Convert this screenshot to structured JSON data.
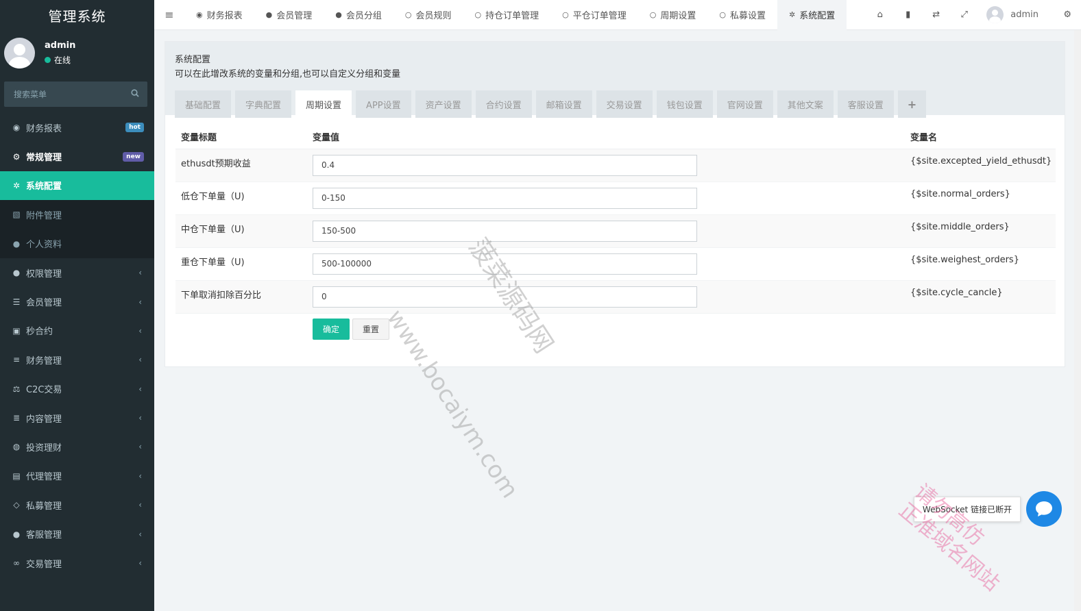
{
  "brand": "管理系统",
  "user": {
    "name": "admin",
    "status": "在线"
  },
  "search": {
    "placeholder": "搜索菜单"
  },
  "sidebar": {
    "items": [
      {
        "label": "财务报表",
        "badge": "hot"
      },
      {
        "label": "常规管理",
        "badge": "new"
      },
      {
        "label": "系统配置"
      },
      {
        "label": "附件管理"
      },
      {
        "label": "个人资料"
      },
      {
        "label": "权限管理"
      },
      {
        "label": "会员管理"
      },
      {
        "label": "秒合约"
      },
      {
        "label": "财务管理"
      },
      {
        "label": "C2C交易"
      },
      {
        "label": "内容管理"
      },
      {
        "label": "投资理财"
      },
      {
        "label": "代理管理"
      },
      {
        "label": "私募管理"
      },
      {
        "label": "客服管理"
      },
      {
        "label": "交易管理"
      }
    ]
  },
  "topnav": {
    "tabs": [
      "财务报表",
      "会员管理",
      "会员分组",
      "会员规则",
      "持仓订单管理",
      "平仓订单管理",
      "周期设置",
      "私募设置",
      "系统配置"
    ],
    "user": "admin"
  },
  "panel": {
    "title": "系统配置",
    "description": "可以在此增改系统的变量和分组,也可以自定义分组和变量",
    "tabs": [
      "基础配置",
      "字典配置",
      "周期设置",
      "APP设置",
      "资产设置",
      "合约设置",
      "邮箱设置",
      "交易设置",
      "钱包设置",
      "官网设置",
      "其他文案",
      "客服设置"
    ],
    "active_tab": "周期设置",
    "table": {
      "headers": [
        "变量标题",
        "变量值",
        "变量名"
      ],
      "rows": [
        {
          "title": "ethusdt预期收益",
          "value": "0.4",
          "name": "{$site.excepted_yield_ethusdt}"
        },
        {
          "title": "低仓下单量（U)",
          "value": "0-150",
          "name": "{$site.normal_orders}"
        },
        {
          "title": "中仓下单量（U)",
          "value": "150-500",
          "name": "{$site.middle_orders}"
        },
        {
          "title": "重仓下单量（U)",
          "value": "500-100000",
          "name": "{$site.weighest_orders}"
        },
        {
          "title": "下单取消扣除百分比",
          "value": "0",
          "name": "{$site.cycle_cancle}"
        }
      ]
    },
    "buttons": {
      "ok": "确定",
      "reset": "重置"
    }
  },
  "toast": "WebSocket 链接已断开",
  "watermarks": [
    "菠菜源码网",
    "www.bocaiym.com",
    "请勿高仿",
    "正准域名网站"
  ],
  "colors": {
    "sidebar_bg": "#222d32",
    "accent": "#18bc9c",
    "hot_badge": "#3c8dbc",
    "new_badge": "#605ca8",
    "chat_button": "#1e88e5"
  }
}
